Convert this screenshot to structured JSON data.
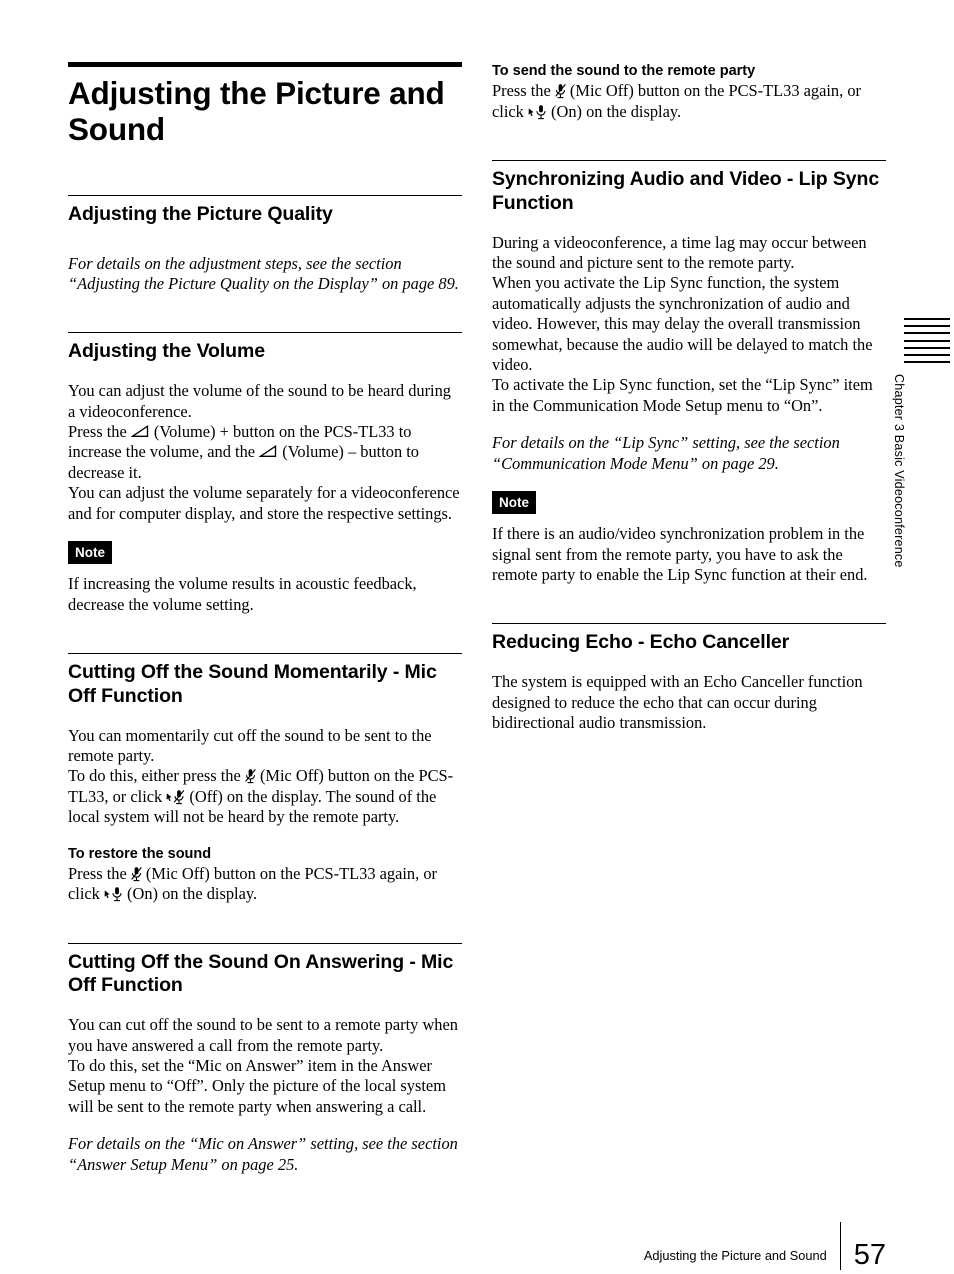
{
  "document": {
    "title": "Adjusting the Picture and Sound",
    "page_number": "57",
    "chapter_label": "Chapter 3  Basic Videoconference",
    "chapter_rule_count": 7
  },
  "left_column": {
    "main_title": "Adjusting the Picture and Sound",
    "sections": [
      {
        "heading": "Adjusting the Picture Quality",
        "reference": "For details on the adjustment steps, see the section “Adjusting the Picture Quality on the Display” on page 89."
      },
      {
        "heading": "Adjusting the Volume",
        "para_1": "You can adjust the volume of the sound to be heard during a videoconference.",
        "para_2_a": "Press the ",
        "para_2_icon_1": "volume-icon",
        "para_2_b": " (Volume) + button on the PCS-TL33 to increase the volume, and the ",
        "para_2_icon_2": "volume-icon",
        "para_2_c": " (Volume) – button to decrease it.",
        "para_3": "You can adjust the volume separately for a videoconference and for computer display, and store the respective settings.",
        "note_label": "Note",
        "note_text": "If increasing the volume results in acoustic feedback, decrease the volume setting."
      },
      {
        "heading": "Cutting Off the Sound Momentarily - Mic Off Function",
        "para_1": "You can momentarily cut off the sound to be sent to the remote party.",
        "para_2_a": "To do this, either press the ",
        "para_2_icon_1": "mic-off-icon",
        "para_2_b": " (Mic Off) button on the PCS-TL33, or click ",
        "para_2_icon_2": "mic-off-pointer-icon",
        "para_2_c": " (Off) on the display. The sound of the local system will not be heard by the remote party.",
        "subheading": "To restore the sound",
        "para_3_a": "Press the ",
        "para_3_icon_1": "mic-off-icon",
        "para_3_b": " (Mic Off) button on the PCS-TL33 again, or click ",
        "para_3_icon_2": "mic-on-pointer-icon",
        "para_3_c": " (On) on the display."
      },
      {
        "heading": "Cutting Off the Sound On Answering - Mic Off Function",
        "para_1": "You can cut off the sound to be sent to a remote party when you have answered a call from the remote party.",
        "para_2": "To do this, set the “Mic on Answer” item in the Answer Setup menu to “Off”. Only the picture of the local system will be sent to the remote party when answering a call.",
        "reference": "For details on the “Mic on Answer” setting, see the section “Answer Setup Menu” on page 25."
      }
    ]
  },
  "right_column": {
    "sections": [
      {
        "subheading": "To send the sound to the remote party",
        "para_a": "Press the ",
        "icon_1": "mic-off-icon",
        "para_b": " (Mic Off) button on the PCS-TL33 again, or click ",
        "icon_2": "mic-on-pointer-icon",
        "para_c": " (On) on the display."
      },
      {
        "heading": "Synchronizing Audio and Video - Lip Sync Function",
        "para_1": "During a videoconference, a time lag may occur between the sound and picture sent to the remote party.",
        "para_2": "When you activate the Lip Sync function, the system automatically adjusts the synchronization of audio and video. However, this may delay the overall transmission somewhat, because the audio will be delayed to match the video.",
        "para_3": "To activate the Lip Sync function, set the “Lip Sync” item in the Communication Mode Setup menu to “On”.",
        "reference": "For details on the “Lip Sync” setting, see the section “Communication Mode Menu” on page 29.",
        "note_label": "Note",
        "note_text": "If there is an audio/video synchronization problem in the signal sent from the remote party, you have to ask the remote party to enable the Lip Sync function at their end."
      },
      {
        "heading": "Reducing Echo - Echo Canceller",
        "para_1": "The system is equipped with an Echo Canceller function designed to reduce the echo that can occur during bidirectional audio transmission."
      }
    ]
  },
  "footer": {
    "running_title": "Adjusting the Picture and Sound",
    "page_number": "57"
  }
}
